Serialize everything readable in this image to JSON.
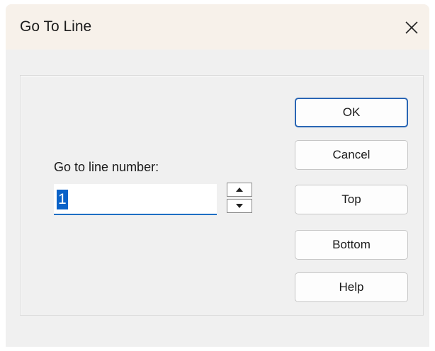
{
  "window": {
    "title": "Go To Line",
    "close_icon": "close-icon"
  },
  "form": {
    "label": "Go to line number:",
    "line_value": "1"
  },
  "buttons": {
    "ok": "OK",
    "cancel": "Cancel",
    "top": "Top",
    "bottom": "Bottom",
    "help": "Help"
  },
  "colors": {
    "titlebar": "#f7f1ea",
    "dialog": "#f0f0f0",
    "accent": "#2a66b4",
    "selection": "#0a62c8"
  }
}
